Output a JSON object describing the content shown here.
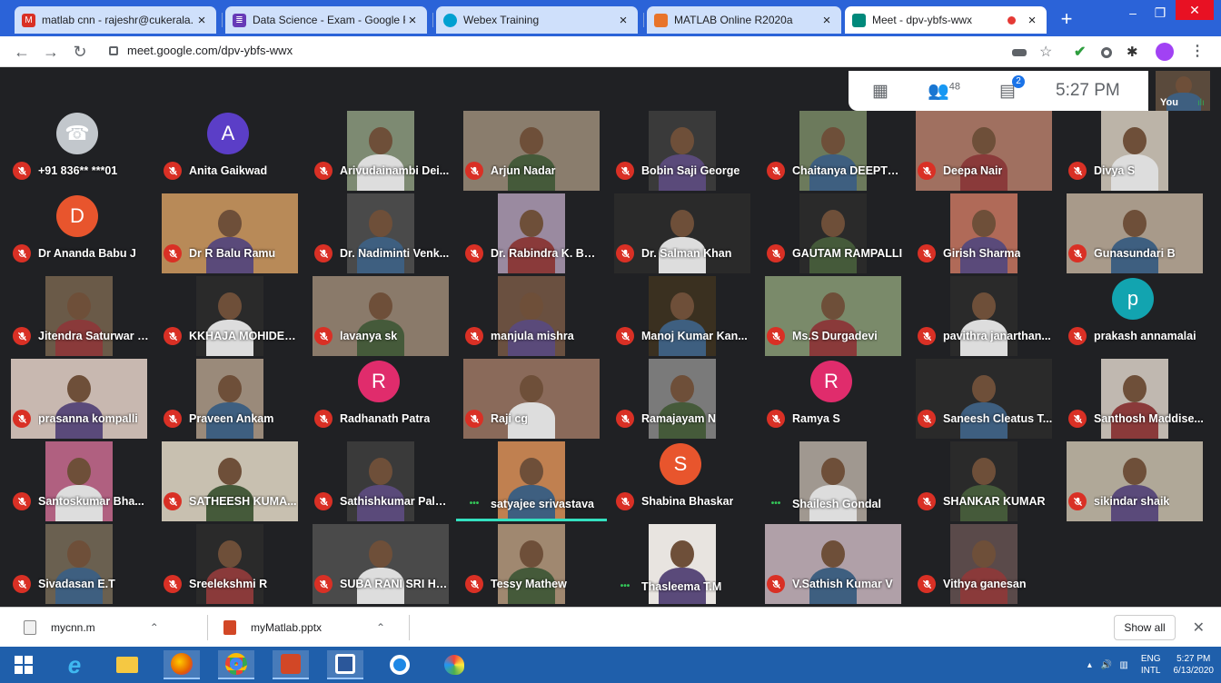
{
  "browser": {
    "tabs": [
      {
        "title": "matlab cnn - rajeshr@cukerala.",
        "favicon": "gmail-icon",
        "color": "#d93025"
      },
      {
        "title": "Data Science - Exam - Google F",
        "favicon": "forms-icon",
        "color": "#673ab7"
      },
      {
        "title": "Webex Training",
        "favicon": "webex-icon",
        "color": "#00a0d1"
      },
      {
        "title": "MATLAB Online R2020a",
        "favicon": "matlab-icon",
        "color": "#e8742a"
      },
      {
        "title": "Meet - dpv-ybfs-wwx",
        "favicon": "meet-icon",
        "color": "#00897b",
        "active": true
      }
    ],
    "new_tab": "+",
    "window_buttons": {
      "minimize": "–",
      "maximize": "❐",
      "close": "✕"
    },
    "url": "meet.google.com/dpv-ybfs-wwx"
  },
  "meet": {
    "participant_count": "48",
    "chat_badge": "2",
    "time": "5:27 PM",
    "self_label": "You",
    "participants": [
      {
        "name": "+91 836** ***01",
        "type": "avatar",
        "letter": "☎",
        "color": "#c2c7cc"
      },
      {
        "name": "Anita Gaikwad",
        "type": "avatar",
        "letter": "A",
        "color": "#5b3ec7"
      },
      {
        "name": "Arivudainambi Dei...",
        "type": "video",
        "bg": "#7d8a72"
      },
      {
        "name": "Arjun Nadar",
        "type": "video",
        "bg": "#8a7d6d"
      },
      {
        "name": "Bobin Saji George",
        "type": "video",
        "bg": "#3a3a3a"
      },
      {
        "name": "Chaitanya DEEPTH...",
        "type": "video",
        "bg": "#6c7a5c"
      },
      {
        "name": "Deepa Nair",
        "type": "video",
        "bg": "#a07060"
      },
      {
        "name": "Divya S",
        "type": "video",
        "bg": "#bcb4a8"
      },
      {
        "name": "Dr Ananda Babu J",
        "type": "avatar",
        "letter": "D",
        "color": "#e8552d"
      },
      {
        "name": "Dr R Balu Ramu",
        "type": "video",
        "bg": "#b88a58"
      },
      {
        "name": "Dr. Nadiminti Venk...",
        "type": "video",
        "bg": "#4a4a4a"
      },
      {
        "name": "Dr. Rabindra K. Barik",
        "type": "video",
        "bg": "#9a8aa0"
      },
      {
        "name": "Dr. Salman Khan",
        "type": "video",
        "bg": "#2a2a2a"
      },
      {
        "name": "GAUTAM RAMPALLI",
        "type": "video",
        "bg": "#2a2a2a"
      },
      {
        "name": "Girish Sharma",
        "type": "video",
        "bg": "#b06a58"
      },
      {
        "name": "Gunasundari B",
        "type": "video",
        "bg": "#a89a8a"
      },
      {
        "name": "Jitendra Saturwar [...",
        "type": "video",
        "bg": "#6a5a48"
      },
      {
        "name": "KKHAJA MOHIDEE...",
        "type": "video",
        "bg": "#2a2a2a"
      },
      {
        "name": "lavanya sk",
        "type": "video",
        "bg": "#8a7a6a"
      },
      {
        "name": "manjula mishra",
        "type": "video",
        "bg": "#6a5040"
      },
      {
        "name": "Manoj Kumar Kan...",
        "type": "video",
        "bg": "#3a3020"
      },
      {
        "name": "Ms.S Durgadevi",
        "type": "video",
        "bg": "#7a8a6a"
      },
      {
        "name": "pavithra janarthan...",
        "type": "video",
        "bg": "#2a2a2a"
      },
      {
        "name": "prakash annamalai",
        "type": "avatar",
        "letter": "p",
        "color": "#12a4b0"
      },
      {
        "name": "prasanna kompalli",
        "type": "video",
        "bg": "#c8b8b0"
      },
      {
        "name": "Praveen Ankam",
        "type": "video",
        "bg": "#9a8a7a"
      },
      {
        "name": "Radhanath Patra",
        "type": "avatar",
        "letter": "R",
        "color": "#e02c6c"
      },
      {
        "name": "Raji cg",
        "type": "video",
        "bg": "#8a6a5a"
      },
      {
        "name": "Ramajayam N",
        "type": "video",
        "bg": "#7a7a7a"
      },
      {
        "name": "Ramya S",
        "type": "avatar",
        "letter": "R",
        "color": "#e02c6c"
      },
      {
        "name": "Saneesh Cleatus T...",
        "type": "video",
        "bg": "#2a2a2a"
      },
      {
        "name": "Santhosh Maddise...",
        "type": "video",
        "bg": "#c0b8b0"
      },
      {
        "name": "Santoskumar Bha...",
        "type": "video",
        "bg": "#b06080"
      },
      {
        "name": "SATHEESH KUMA...",
        "type": "video",
        "bg": "#c8c0b0"
      },
      {
        "name": "Sathishkumar Pala...",
        "type": "video",
        "bg": "#3a3a3a"
      },
      {
        "name": "satyajee srivastava",
        "type": "video",
        "bg": "#c08050",
        "speaking": true
      },
      {
        "name": "Shabina Bhaskar",
        "type": "avatar",
        "letter": "S",
        "color": "#e8552d"
      },
      {
        "name": "Shailesh Gondal",
        "type": "video",
        "bg": "#a09890",
        "speaking_dots": true
      },
      {
        "name": "SHANKAR KUMAR",
        "type": "video",
        "bg": "#2a2a2a"
      },
      {
        "name": "sikindar shaik",
        "type": "video",
        "bg": "#b0a898"
      },
      {
        "name": "Sivadasan E.T",
        "type": "video",
        "bg": "#6a6050"
      },
      {
        "name": "Sreelekshmi R",
        "type": "video",
        "bg": "#2a2a2a"
      },
      {
        "name": "SUBA RANI SRI HA...",
        "type": "video",
        "bg": "#4a4a4a"
      },
      {
        "name": "Tessy Mathew",
        "type": "video",
        "bg": "#a08870"
      },
      {
        "name": "Thasleema T.M",
        "type": "video",
        "bg": "#e8e4e0",
        "speaking_dots": true
      },
      {
        "name": "V.Sathish Kumar V",
        "type": "video",
        "bg": "#b0a0a8"
      },
      {
        "name": "Vithya ganesan",
        "type": "video",
        "bg": "#5a4a4a"
      }
    ]
  },
  "downloads": {
    "items": [
      {
        "name": "mycnn.m",
        "icon": "m-file-icon"
      },
      {
        "name": "myMatlab.pptx",
        "icon": "pptx-file-icon"
      }
    ],
    "show_all": "Show all",
    "close": "✕"
  },
  "taskbar": {
    "apps": [
      "windows-start-icon",
      "internet-explorer-icon",
      "file-explorer-icon",
      "firefox-icon",
      "chrome-icon",
      "powerpoint-icon",
      "word-icon",
      "quicktime-icon",
      "paint-icon"
    ],
    "tray": {
      "lang1": "ENG",
      "lang2": "INTL",
      "time": "5:27 PM",
      "date": "6/13/2020"
    }
  }
}
